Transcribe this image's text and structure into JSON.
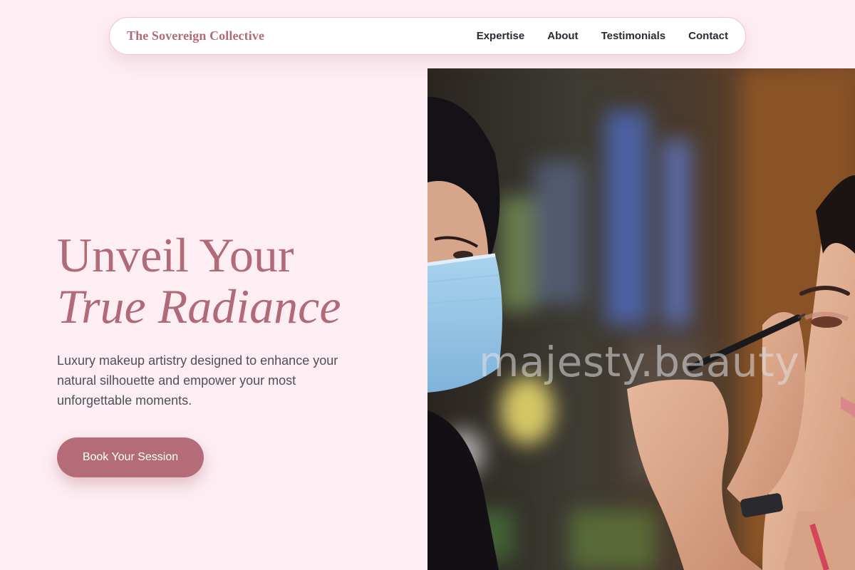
{
  "header": {
    "brand": "The Sovereign Collective",
    "nav": [
      {
        "label": "Expertise"
      },
      {
        "label": "About"
      },
      {
        "label": "Testimonials"
      },
      {
        "label": "Contact"
      }
    ]
  },
  "hero": {
    "headline_line1": "Unveil Your",
    "headline_line2": "True Radiance",
    "subtext": "Luxury makeup artistry designed to enhance your natural silhouette and empower your most unforgettable moments.",
    "cta_label": "Book Your Session"
  },
  "image": {
    "watermark": "majesty.beauty",
    "description_icon": "makeup-artist-photo"
  },
  "colors": {
    "background": "#fdeef3",
    "accent": "#b06a78",
    "button": "#b46c79",
    "text": "#4f4f5a"
  }
}
